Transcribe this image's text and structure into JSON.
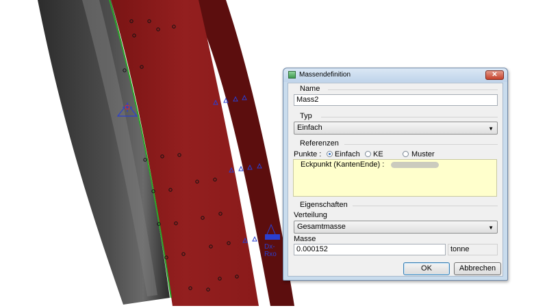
{
  "viewport": {
    "labels": [
      "Dx-",
      "Rxo"
    ]
  },
  "dialog": {
    "title": "Massendefinition",
    "close_symbol": "✕",
    "name_group": {
      "label": "Name",
      "value": "Mass2"
    },
    "type_group": {
      "label": "Typ",
      "selected": "Einfach"
    },
    "references_group": {
      "label": "Referenzen",
      "points_label": "Punkte :",
      "radio_options": [
        "Einfach",
        "KE",
        "Muster"
      ],
      "selected_option": "Einfach",
      "reference_item": "Eckpunkt (KantenEnde) :"
    },
    "properties_group": {
      "label": "Eigenschaften",
      "distribution_label": "Verteilung",
      "distribution_selected": "Gesamtmasse",
      "mass_label": "Masse",
      "mass_value": "0.000152",
      "mass_unit": "tonne"
    },
    "buttons": {
      "ok": "OK",
      "cancel": "Abbrechen"
    }
  },
  "colors": {
    "model_red": "#8c1c1c",
    "model_gray": "#3a3a3a",
    "marker_blue": "#2a3fd0",
    "dialog_frame": "#c9dced"
  }
}
